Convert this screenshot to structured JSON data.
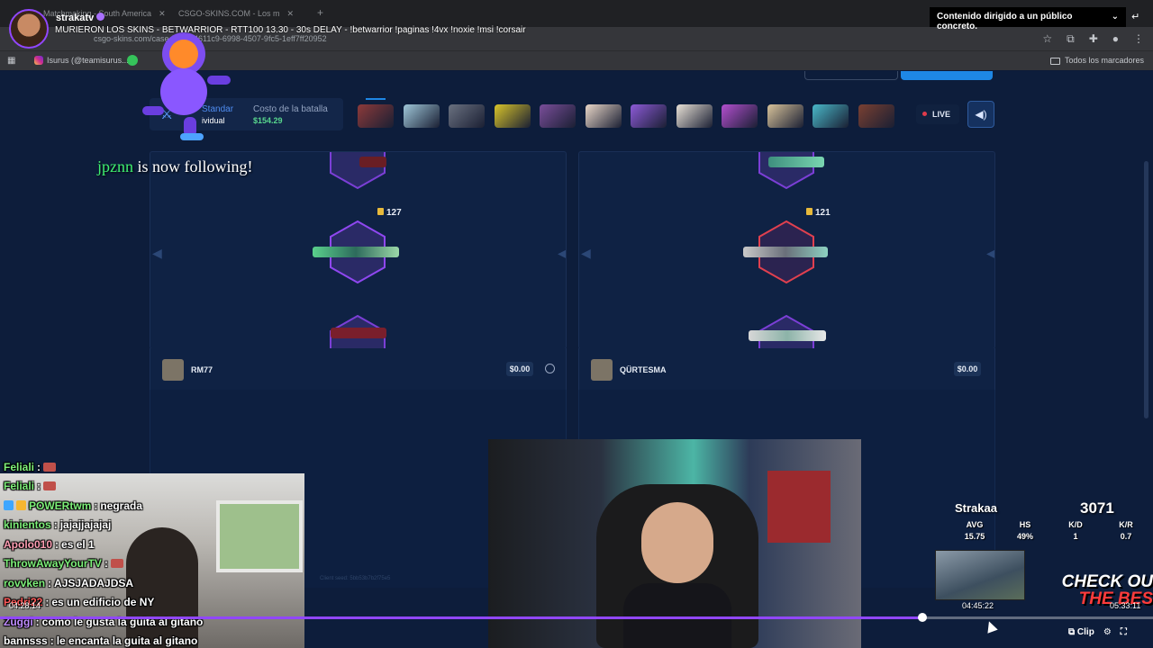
{
  "browser": {
    "tabs": [
      {
        "label": "Matchmaking - South America"
      },
      {
        "label": "CSGO-SKINS.COM - Los m"
      }
    ],
    "new_tab_icon": "plus-icon",
    "url": "csgo-skins.com/case-battle/4611c9-6998-4507-9fc5-1eff7ff20952",
    "bookmarks": [
      {
        "label": "Isurus (@teamisurus..."
      }
    ],
    "all_bookmarks_label": "Todos los marcadores"
  },
  "stream": {
    "channel": "strakatv",
    "title": "MURIERON LOS SKINS - BETWARRIOR - RTT100 13.30 - 30s DELAY - !betwarrior !paginas !4vx !noxie !msi !corsair",
    "audience_notice": "Contenido dirigido a un público concreto."
  },
  "battle": {
    "mode_name": "Standar",
    "mode_sub": "ividual",
    "cost_label": "Costo de la batalla",
    "cost_value": "$154.29",
    "live_label": "LIVE",
    "cases": [
      {
        "color": "#8d3a3a"
      },
      {
        "color": "#9fc7d9"
      },
      {
        "color": "#6a7180"
      },
      {
        "color": "#d8c42a"
      },
      {
        "color": "#7a4e9a"
      },
      {
        "color": "#e9d7c8"
      },
      {
        "color": "#8d5ad8"
      },
      {
        "color": "#e8e1d6"
      },
      {
        "color": "#b34fcf"
      },
      {
        "color": "#d8c39a"
      },
      {
        "color": "#49b8c9"
      },
      {
        "color": "#7a4032"
      }
    ]
  },
  "players": [
    {
      "name": "RM77",
      "amount": "$0.00",
      "tickets": "127"
    },
    {
      "name": "QÜRTESMA",
      "amount": "$0.00",
      "tickets": "121"
    }
  ],
  "client_seed": "Client seed: 5bb53b7b2f75e5",
  "follow": {
    "name": "jpznn",
    "text": "is now following!"
  },
  "chat": [
    {
      "user": "Feliali",
      "color": "#7ef07a",
      "text": "",
      "emote": true
    },
    {
      "user": "Feliali",
      "color": "#7ef07a",
      "text": "",
      "emote": true
    },
    {
      "user": "POWERtwm",
      "color": "#7ef07a",
      "text": "negrada",
      "emote": false,
      "badges": true
    },
    {
      "user": "kinientos",
      "color": "#7ef07a",
      "text": "jajajjajajaj",
      "emote": false
    },
    {
      "user": "Apolo010",
      "color": "#ff9fb4",
      "text": "es el 1",
      "emote": false
    },
    {
      "user": "ThrowAwayYourTV",
      "color": "#7ef07a",
      "text": "",
      "emote": true
    },
    {
      "user": "rovvken",
      "color": "#7ef07a",
      "text": "AJSJADAJDSA",
      "emote": false
    },
    {
      "user": "Pedri22",
      "color": "#ff5a5a",
      "text": "es un edificio de NY",
      "emote": false
    },
    {
      "user": "Zuggi",
      "color": "#c08cff",
      "text": "como le gusta la guita al gitano",
      "emote": false
    },
    {
      "user": "bannsss",
      "color": "#ffffff",
      "text": "le encanta la guita al gitano",
      "emote": false
    }
  ],
  "stats": {
    "name": "Strakaa",
    "elo": "3071",
    "avg_label": "AVG",
    "avg": "15.75",
    "hs_label": "HS",
    "hs": "49%",
    "kd_label": "K/D",
    "kd": "1",
    "kr_label": "K/R",
    "kr": "0.7"
  },
  "ad": {
    "line1": "CHECK OU",
    "line2": "THE BES"
  },
  "player": {
    "progress": 0.8,
    "clip_time": "04:28:14",
    "hover_time": "04:45:22",
    "duration": "05:33:11",
    "clip_label": "Clip"
  },
  "colors": {
    "accent": "#9147ff",
    "site_bg": "#0d1d3b",
    "brand_blue": "#1e87e5",
    "green": "#58d68d"
  }
}
